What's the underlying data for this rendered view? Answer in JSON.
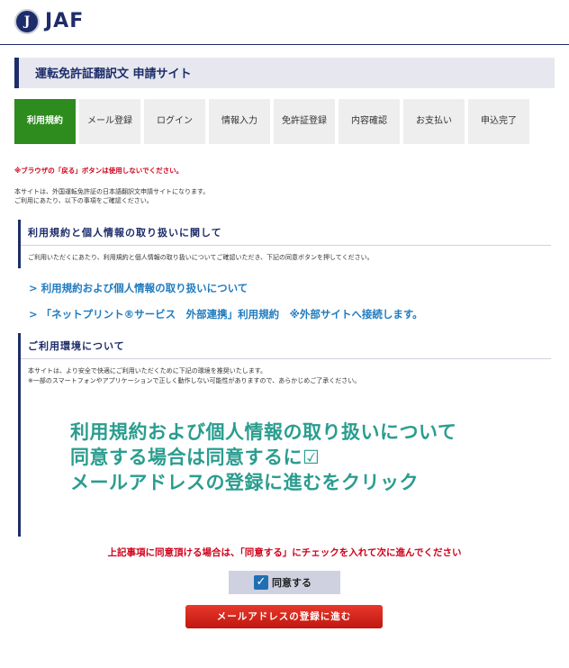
{
  "header": {
    "logo_mark": "JAF",
    "logo_text": "JAF"
  },
  "title": "運転免許証翻訳文 申請サイト",
  "steps": [
    {
      "label": "利用規約",
      "active": true
    },
    {
      "label": "メール登録",
      "active": false
    },
    {
      "label": "ログイン",
      "active": false
    },
    {
      "label": "情報入力",
      "active": false
    },
    {
      "label": "免許証登録",
      "active": false
    },
    {
      "label": "内容確認",
      "active": false
    },
    {
      "label": "お支払い",
      "active": false
    },
    {
      "label": "申込完了",
      "active": false
    }
  ],
  "warning": "※ブラウザの「戻る」ボタンは使用しないでください。",
  "intro": {
    "line1": "本サイトは、外国運転免許証の日本語翻訳文申請サイトになります。",
    "line2": "ご利用にあたり、以下の事項をご確認ください。"
  },
  "section1": {
    "heading": "利用規約と個人情報の取り扱いに関して",
    "text": "ご利用いただくにあたり、利用規約と個人情報の取り扱いについてご確認いただき、下記の同意ボタンを押してください。"
  },
  "links": {
    "terms": "> 利用規約および個人情報の取り扱いについて",
    "netprint": "> 「ネットプリント®サービス　外部連携」利用規約　※外部サイトへ接続します。"
  },
  "section2": {
    "heading": "ご利用環境について",
    "text1": "本サイトは、より安全で快適にご利用いただくために下記の環境を推奨いたします。",
    "text2": "※一部のスマートフォンやアプリケーションで正しく動作しない可能性がありますので、あらかじめご了承ください。"
  },
  "overlay": {
    "line1": "利用規約および個人情報の取り扱いについて",
    "line2": "同意する場合は同意するに☑",
    "line3": "メールアドレスの登録に進むをクリック"
  },
  "agree_message": "上記事項に同意頂ける場合は、「同意する」にチェックを入れて次に進んでください",
  "agree_checkbox": {
    "label": "同意する",
    "checked": true
  },
  "next_button": "メールアドレスの登録に進む",
  "colors": {
    "brand_navy": "#1d2d6b",
    "active_step": "#2e8b1e",
    "warning_red": "#d0021b",
    "link_blue": "#1f7bbf",
    "overlay_teal": "#2a9d8f"
  }
}
